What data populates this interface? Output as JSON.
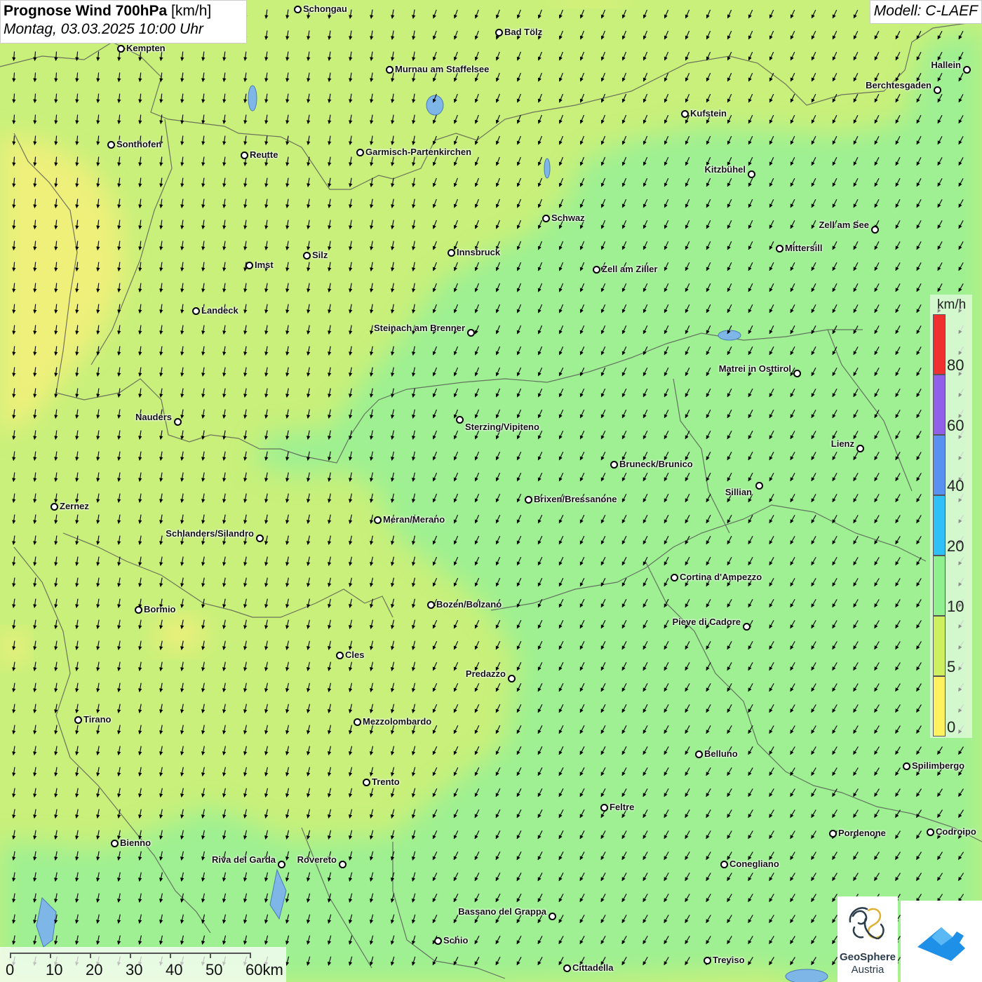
{
  "header": {
    "title_bold": "Prognose Wind 700hPa",
    "title_unit": " [km/h]",
    "datetime": "Montag, 03.03.2025 10:00 Uhr",
    "model": "Modell: C-LAEF"
  },
  "legend": {
    "unit": "km/h",
    "bins": [
      {
        "label": "80",
        "color": "#f03030"
      },
      {
        "label": "60",
        "color": "#9060e8"
      },
      {
        "label": "40",
        "color": "#5a90f0"
      },
      {
        "label": "20",
        "color": "#30c0f8"
      },
      {
        "label": "10",
        "color": "#90f090"
      },
      {
        "label": "5",
        "color": "#cef060"
      },
      {
        "label": "0",
        "color": "#fff260"
      }
    ]
  },
  "scale_bar": {
    "labels": [
      "0",
      "10",
      "20",
      "30",
      "40",
      "50",
      "60km"
    ]
  },
  "cities": [
    {
      "name": "Schongau"
    },
    {
      "name": "Bad Tölz"
    },
    {
      "name": "Kempten"
    },
    {
      "name": "Murnau am Staffelsee"
    },
    {
      "name": "Hallein"
    },
    {
      "name": "Berchtesgaden"
    },
    {
      "name": "Kufstein"
    },
    {
      "name": "Sonthofen"
    },
    {
      "name": "Reutte"
    },
    {
      "name": "Garmisch-Partenkirchen"
    },
    {
      "name": "Kitzbühel"
    },
    {
      "name": "Schwaz"
    },
    {
      "name": "Zell am See"
    },
    {
      "name": "Innsbruck"
    },
    {
      "name": "Mittersill"
    },
    {
      "name": "Silz"
    },
    {
      "name": "Imst"
    },
    {
      "name": "Zell am Ziller"
    },
    {
      "name": "Landeck"
    },
    {
      "name": "Steinach am Brenner"
    },
    {
      "name": "Matrei in Osttirol"
    },
    {
      "name": "Nauders"
    },
    {
      "name": "Sterzing/Vipiteno"
    },
    {
      "name": "Lienz"
    },
    {
      "name": "Bruneck/Brunico"
    },
    {
      "name": "Sillian"
    },
    {
      "name": "Brixen/Bressanone"
    },
    {
      "name": "Zernez"
    },
    {
      "name": "Meran/Merano"
    },
    {
      "name": "Schlanders/Silandro"
    },
    {
      "name": "Cortina d'Ampezzo"
    },
    {
      "name": "Bozen/Bolzano"
    },
    {
      "name": "Bormio"
    },
    {
      "name": "Pieve di Cadore"
    },
    {
      "name": "Cles"
    },
    {
      "name": "Predazzo"
    },
    {
      "name": "Tirano"
    },
    {
      "name": "Mezzolombardo"
    },
    {
      "name": "Belluno"
    },
    {
      "name": "Spilimbergo"
    },
    {
      "name": "Trento"
    },
    {
      "name": "Feltre"
    },
    {
      "name": "Pordenone"
    },
    {
      "name": "Codroipo"
    },
    {
      "name": "Bienno"
    },
    {
      "name": "Riva del Garda"
    },
    {
      "name": "Rovereto"
    },
    {
      "name": "Conegliano"
    },
    {
      "name": "Bassano del Grappa"
    },
    {
      "name": "Schio"
    },
    {
      "name": "Treviso"
    },
    {
      "name": "Cittadella"
    }
  ],
  "logos": {
    "geosphere_name": "GeoSphere",
    "geosphere_sub": "Austria"
  }
}
